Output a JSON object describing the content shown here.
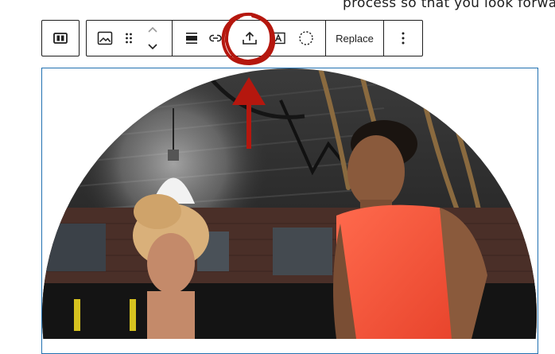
{
  "page": {
    "intro_fragment": "process so that you look forwa"
  },
  "toolbar": {
    "parent_button_icon": "select-parent-icon",
    "items": [
      {
        "name": "image-block-icon"
      },
      {
        "name": "drag-handle-icon"
      },
      {
        "name": "move-up-icon"
      },
      {
        "name": "move-down-icon"
      },
      {
        "name": "align-icon"
      },
      {
        "name": "link-icon"
      },
      {
        "name": "upload-icon"
      },
      {
        "name": "text-overlay-icon"
      },
      {
        "name": "circle-crop-icon"
      }
    ],
    "replace_label": "Replace",
    "more_icon": "more-options-icon"
  },
  "annotation": {
    "color": "#b5170e",
    "shapes": [
      "circle-highlight",
      "arrow-up"
    ]
  },
  "colors": {
    "selection_border": "#2271b1",
    "text": "#1e1e1e"
  }
}
